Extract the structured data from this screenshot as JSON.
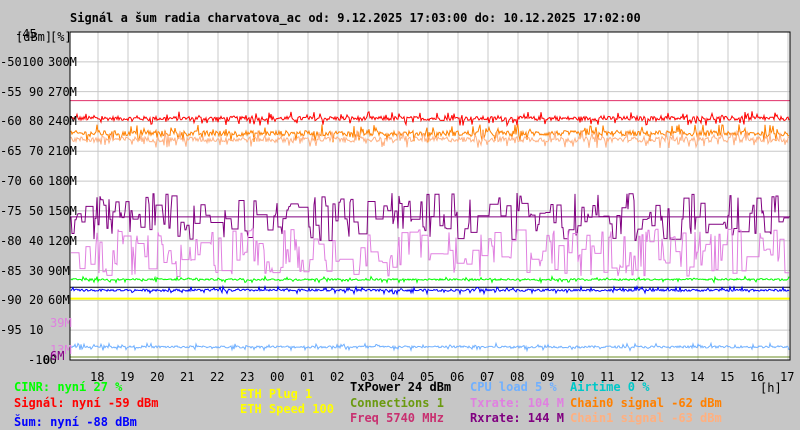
{
  "chart_data": {
    "type": "line",
    "title": "Signál a šum radia charvatova_ac od: 9.12.2025 17:03:00 do: 10.12.2025 17:02:00",
    "xlabel": "[h]",
    "ylabel_units": [
      "[dBm]",
      "[%]"
    ],
    "x_ticks": [
      "18",
      "19",
      "20",
      "21",
      "22",
      "23",
      "00",
      "01",
      "02",
      "03",
      "04",
      "05",
      "06",
      "07",
      "08",
      "09",
      "10",
      "11",
      "12",
      "13",
      "14",
      "15",
      "16",
      "17"
    ],
    "y_dbm_ticks": [
      "-45",
      "-50",
      "-55",
      "-60",
      "-65",
      "-70",
      "-75",
      "-80",
      "-85",
      "-90",
      "-95",
      "-100"
    ],
    "y_pct_ticks": [
      "100",
      "90",
      "80",
      "70",
      "60",
      "50",
      "40",
      "30",
      "20",
      "10",
      "0"
    ],
    "y_rate_ticks": [
      "300M",
      "270M",
      "240M",
      "210M",
      "180M",
      "150M",
      "120M",
      "90M",
      "60M"
    ],
    "extra_rate_ticks": [
      {
        "label": "39M",
        "color": "#e080e0"
      },
      {
        "label": "13M",
        "color": "#e080e0"
      },
      {
        "label": "6M",
        "color": "#800080"
      }
    ],
    "ylim_dbm": [
      -100,
      -45
    ],
    "grid": true,
    "series": [
      {
        "name": "Signál",
        "color": "#ff0000",
        "level_dbm": -59.5,
        "spread": 1.2,
        "now": "-59 dBm"
      },
      {
        "name": "Chain0 signal",
        "color": "#ff8000",
        "level_dbm": -62,
        "spread": 1.5,
        "now": "-62 dBm"
      },
      {
        "name": "Chain1 signal",
        "color": "#ffb080",
        "level_dbm": -63,
        "spread": 1.5,
        "now": "-63 dBm"
      },
      {
        "name": "Rxrate",
        "color": "#800080",
        "level_dbm": -76,
        "spread": 4,
        "now": "144 M"
      },
      {
        "name": "Txrate",
        "color": "#e080e0",
        "level_dbm": -82,
        "spread": 4,
        "now": "104 M"
      },
      {
        "name": "CINR",
        "color": "#00ff00",
        "level_dbm": -86.5,
        "spread": 0.5,
        "now": "27 %"
      },
      {
        "name": "Šum",
        "color": "#0000ff",
        "level_dbm": -88.3,
        "spread": 0.6,
        "now": "-88 dBm"
      },
      {
        "name": "CPU load",
        "color": "#70b0ff",
        "level_dbm": -97.8,
        "spread": 0.6,
        "now": "5 %"
      }
    ],
    "hlines": [
      {
        "name": "max-signal",
        "color": "#e0306a",
        "dbm": -56.5
      },
      {
        "name": "rxrate-now",
        "color": "#800080",
        "dbm": -76
      },
      {
        "name": "noise-ref",
        "color": "#000000",
        "dbm": -87.8
      },
      {
        "name": "eth-speed",
        "color": "#ffff00",
        "dbm": -89.7
      },
      {
        "name": "connections",
        "color": "#6b8e23",
        "dbm": -99.5
      }
    ]
  },
  "legend": {
    "cinr": "CINR: nyní 27 %",
    "signal": "Signál: nyní -59 dBm",
    "noise": "Šum: nyní -88 dBm",
    "eth_plug": "ETH Plug 1",
    "eth_speed": "ETH Speed 100",
    "txpower": "TxPower 24 dBm",
    "connections": "Connections 1",
    "freq": "Freq 5740 MHz",
    "cpu": "CPU load 5 %",
    "txrate": "Txrate: 104 M",
    "rxrate": "Rxrate: 144 M",
    "airtime": "Airtime 0 %",
    "chain0": "Chain0 signal -62 dBm",
    "chain1": "Chain1 signal -63 dBm"
  }
}
